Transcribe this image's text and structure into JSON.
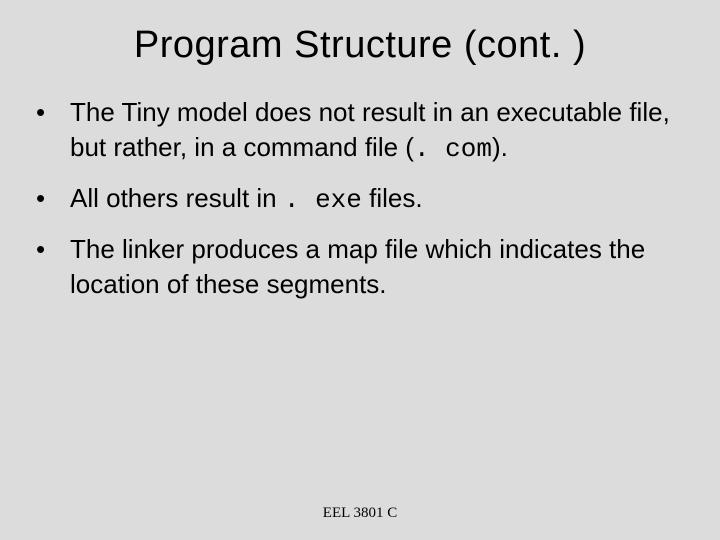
{
  "title": "Program Structure (cont. )",
  "bullets": {
    "b1": {
      "pre": "The Tiny model does not result in an executable file, but rather, in a command file (",
      "mono": ". com",
      "post": ")."
    },
    "b2": {
      "pre": "All others result in ",
      "mono": ". exe",
      "post": " files."
    },
    "b3": {
      "text": "The linker produces a map file which indicates the location of these segments."
    }
  },
  "footer": "EEL 3801 C"
}
